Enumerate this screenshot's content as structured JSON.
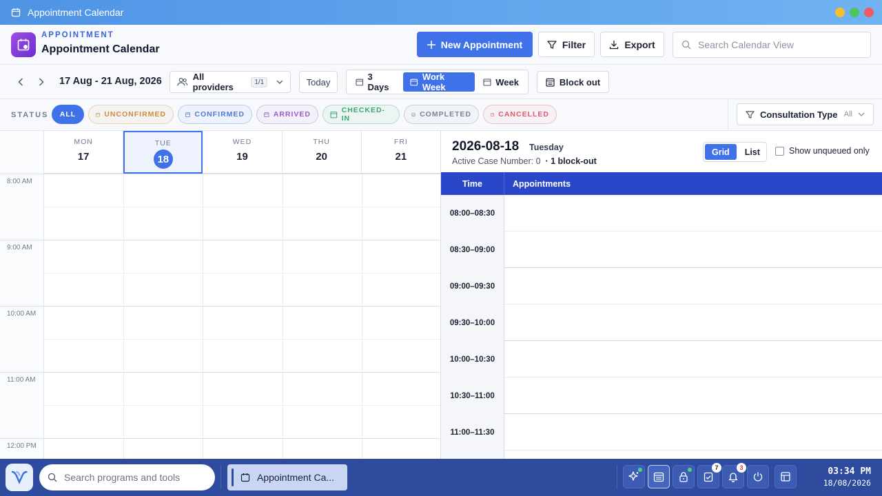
{
  "window": {
    "title": "Appointment Calendar"
  },
  "header": {
    "brand_top": "APPOINTMENT",
    "brand_title": "Appointment Calendar",
    "new_label": "New Appointment",
    "filter_label": "Filter",
    "export_label": "Export",
    "search_placeholder": "Search Calendar View"
  },
  "toolbar": {
    "date_range": "17 Aug - 21 Aug, 2026",
    "providers_label": "All providers",
    "providers_count": "1/1",
    "today_label": "Today",
    "views": [
      "3 Days",
      "Work Week",
      "Week"
    ],
    "active_view": "Work Week",
    "block_label": "Block out"
  },
  "status": {
    "label": "STATUS",
    "chips": [
      {
        "label": "ALL",
        "color": "#3f72e8"
      },
      {
        "label": "UNCONFIRMED",
        "color": "#d08a3c"
      },
      {
        "label": "CONFIRMED",
        "color": "#4f79d9"
      },
      {
        "label": "ARRIVED",
        "color": "#9a5ad0"
      },
      {
        "label": "CHECKED-IN",
        "color": "#3aa86b"
      },
      {
        "label": "COMPLETED",
        "color": "#7b8494"
      },
      {
        "label": "CANCELLED",
        "color": "#e05a6a"
      }
    ],
    "consultation_label": "Consultation Type",
    "consultation_value": "All"
  },
  "calendar": {
    "days": [
      {
        "name": "MON",
        "num": "17"
      },
      {
        "name": "TUE",
        "num": "18"
      },
      {
        "name": "WED",
        "num": "19"
      },
      {
        "name": "THU",
        "num": "20"
      },
      {
        "name": "FRI",
        "num": "21"
      }
    ],
    "selected_day": "18",
    "hours": [
      "8:00 AM",
      "9:00 AM",
      "10:00 AM",
      "11:00 AM",
      "12:00 PM"
    ]
  },
  "detail": {
    "date": "2026-08-18",
    "weekday": "Tuesday",
    "active_case_label": "Active Case Number: 0",
    "blockout_label": "· 1 block-out",
    "grid_label": "Grid",
    "list_label": "List",
    "unqueued_label": "Show unqueued only",
    "col_time": "Time",
    "col_appointments": "Appointments",
    "slots": [
      "08:00–08:30",
      "08:30–09:00",
      "09:00–09:30",
      "09:30–10:00",
      "10:00–10:30",
      "10:30–11:00",
      "11:00–11:30",
      ""
    ]
  },
  "taskbar": {
    "search_placeholder": "Search programs and tools",
    "app_label": "Appointment Ca...",
    "tray_badges": {
      "tasks": "7",
      "notifications": "3"
    },
    "time": "03:34 PM",
    "date": "18/08/2026"
  },
  "colors": {
    "accent": "#3f72e8",
    "table_header": "#2a47c9",
    "taskbar": "#2e4b9e"
  }
}
